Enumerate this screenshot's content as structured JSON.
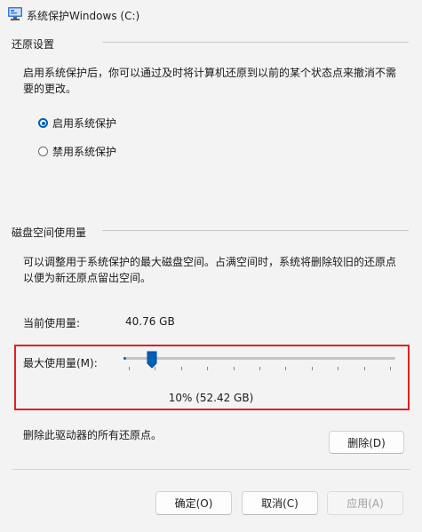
{
  "window": {
    "title": "系统保护Windows (C:)",
    "icon": "system-properties-icon"
  },
  "restore_settings": {
    "heading": "还原设置",
    "description_line1": "启用系统保护后，你可以通过及时将计算机还原到以前的某个状态点来撤消不需",
    "description_line2": "要的更改。",
    "options": [
      {
        "label": "启用系统保护",
        "checked": true
      },
      {
        "label": "禁用系统保护",
        "checked": false
      }
    ]
  },
  "disk_usage": {
    "heading": "磁盘空间使用量",
    "description_line1": "可以调整用于系统保护的最大磁盘空间。占满空间时，系统将删除较旧的还原点",
    "description_line2": "以便为新还原点留出空间。",
    "current_label": "当前使用量:",
    "current_value": "40.76 GB",
    "max_label": "最大使用量(M):",
    "slider_percent": 10,
    "max_value_text": "10% (52.42 GB)"
  },
  "delete_section": {
    "text": "删除此驱动器的所有还原点。",
    "button": "删除(D)"
  },
  "footer": {
    "ok": "确定(O)",
    "cancel": "取消(C)",
    "apply": "应用(A)"
  },
  "colors": {
    "accent": "#005fb8",
    "highlight_border": "#e02020",
    "background": "#f3f3f3"
  }
}
